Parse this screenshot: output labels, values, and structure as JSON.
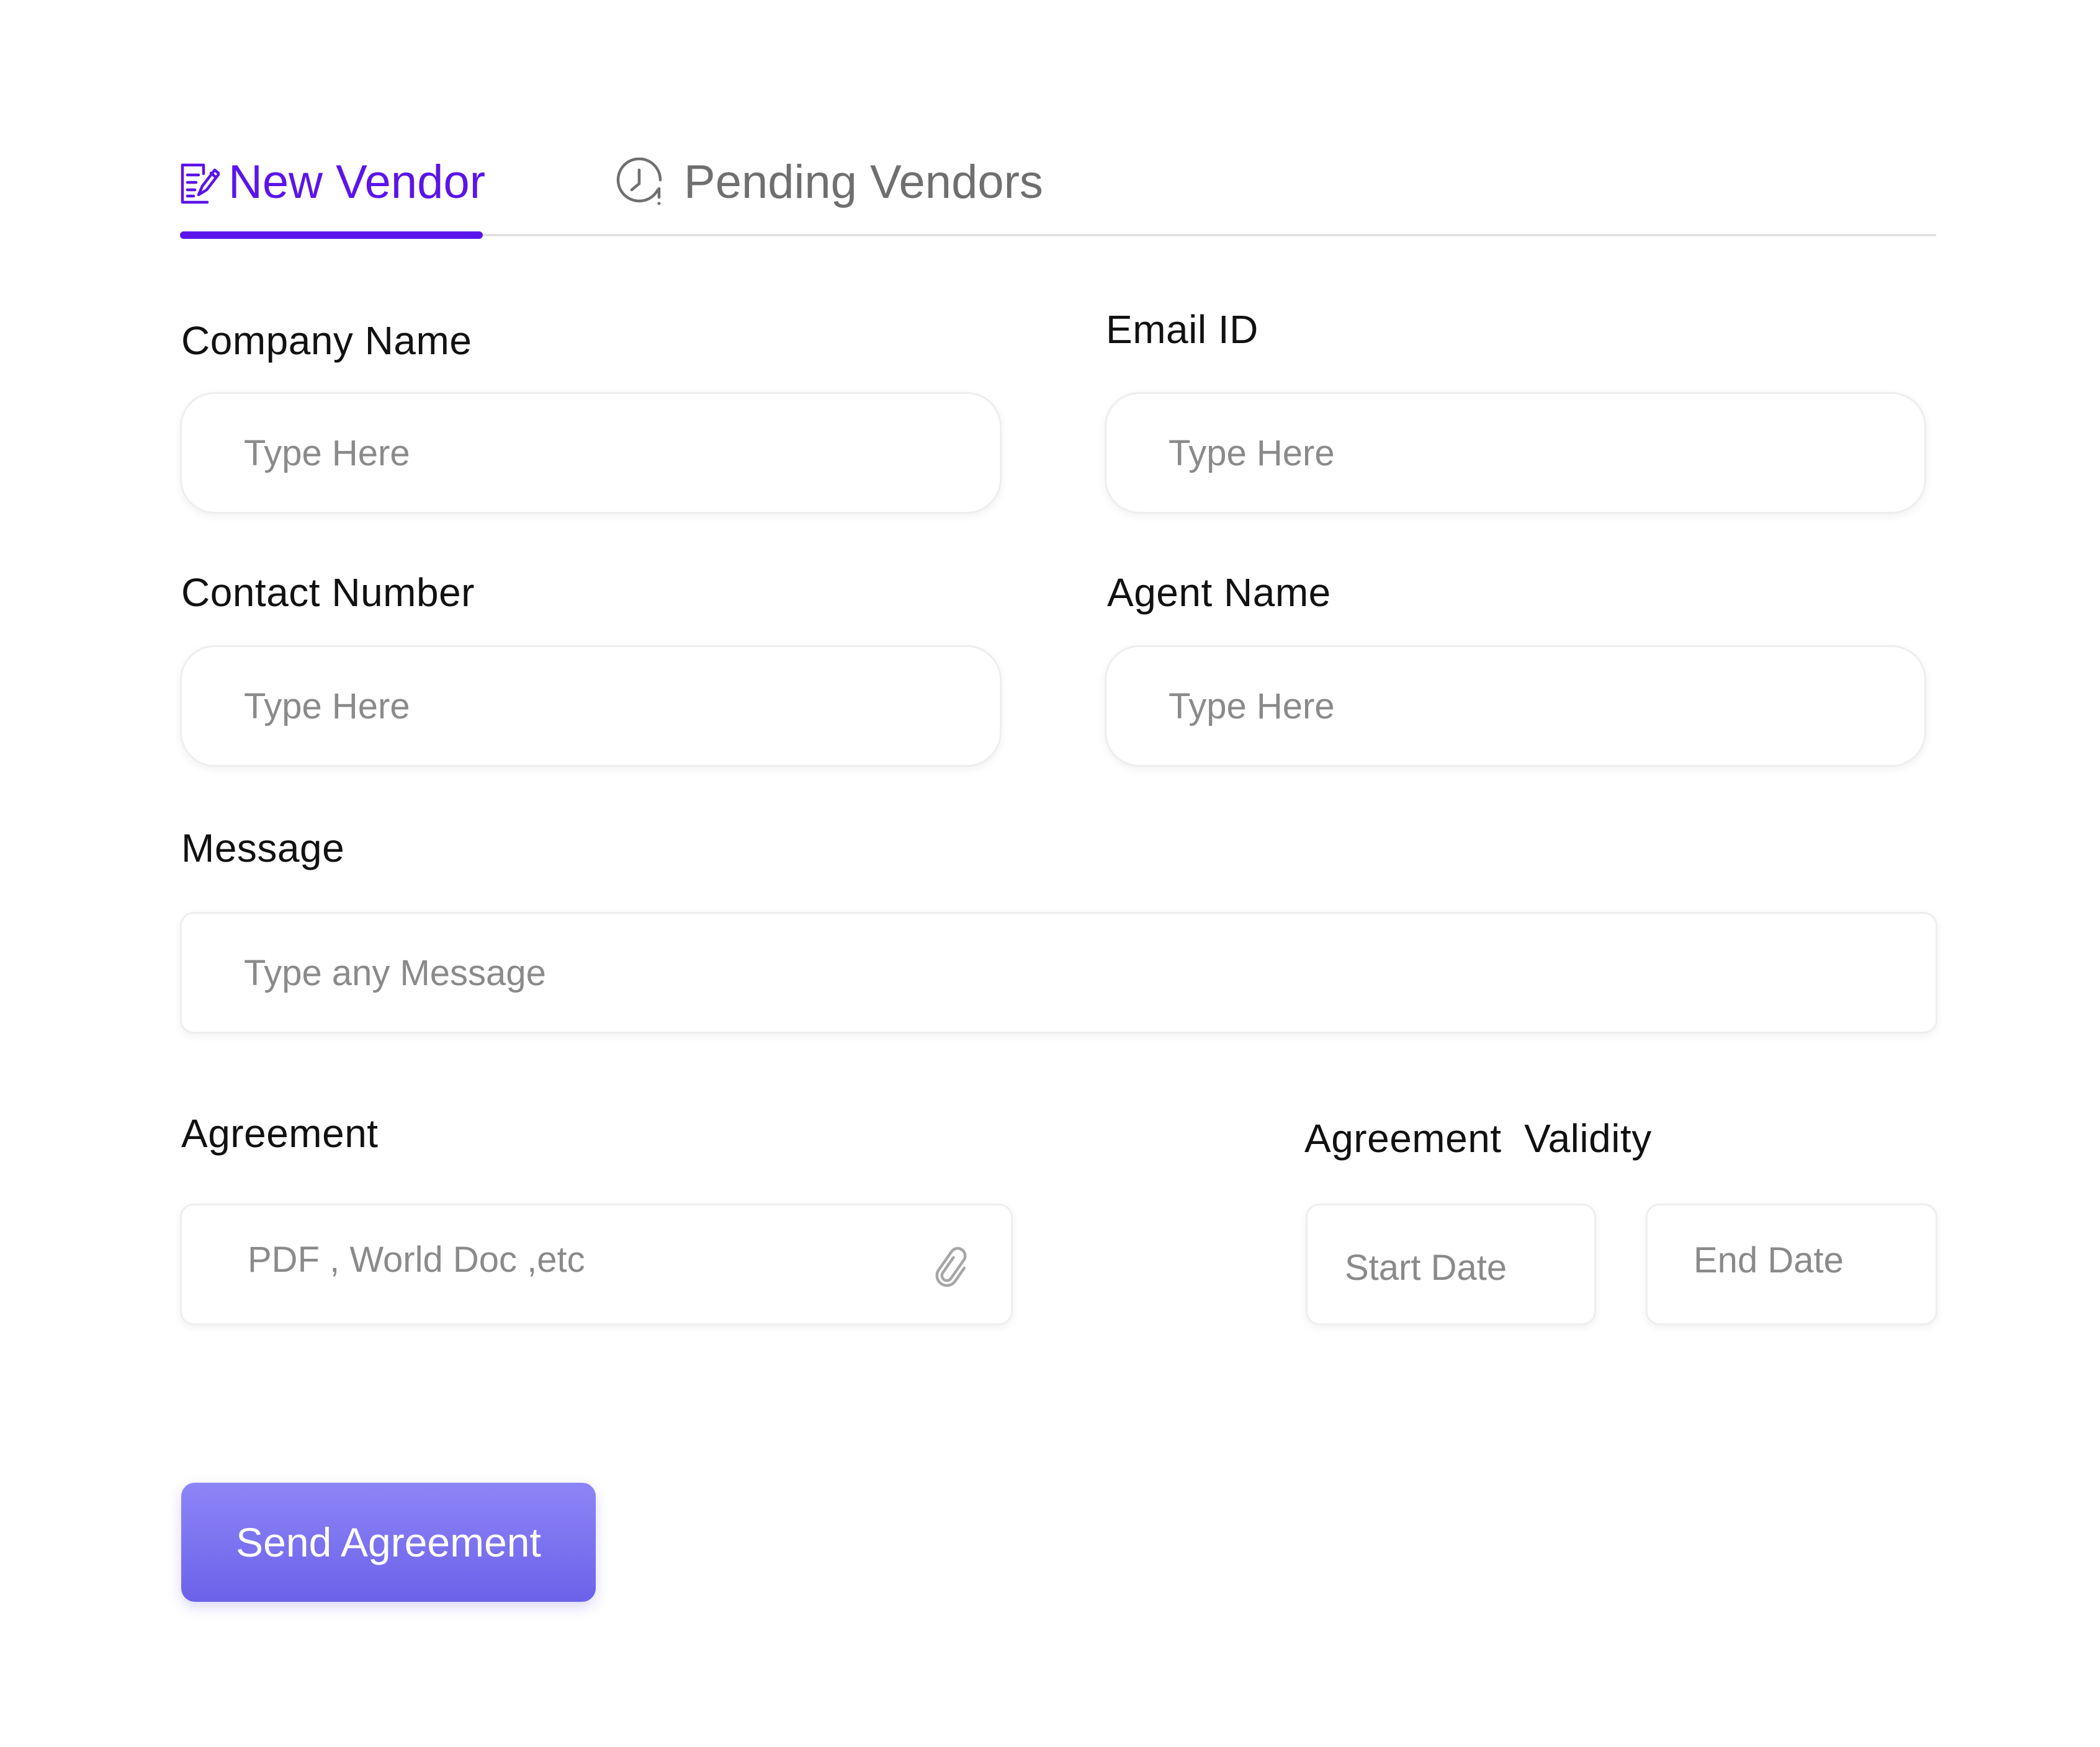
{
  "tabs": [
    {
      "label": "New Vendor",
      "icon": "edit-document-icon",
      "active": true
    },
    {
      "label": "Pending Vendors",
      "icon": "clock-pending-icon",
      "active": false
    }
  ],
  "form": {
    "company_name": {
      "label": "Company Name",
      "placeholder": "Type Here"
    },
    "email_id": {
      "label": "Email ID",
      "placeholder": "Type Here"
    },
    "contact_number": {
      "label": "Contact Number",
      "placeholder": "Type Here"
    },
    "agent_name": {
      "label": "Agent Name",
      "placeholder": "Type Here"
    },
    "message": {
      "label": "Message",
      "placeholder": "Type any Message"
    },
    "agreement": {
      "label": "Agreement",
      "placeholder": "PDF , World Doc ,etc",
      "icon": "paperclip-icon"
    },
    "agreement_validity": {
      "label": "Agreement  Validity",
      "start_placeholder": "Start Date",
      "end_placeholder": "End Date"
    }
  },
  "actions": {
    "send_label": "Send Agreement"
  },
  "colors": {
    "accent": "#5b14ea",
    "inactive_tab": "#6f6f6f",
    "button_top": "#8d85f6",
    "button_bottom": "#6b62ea"
  }
}
